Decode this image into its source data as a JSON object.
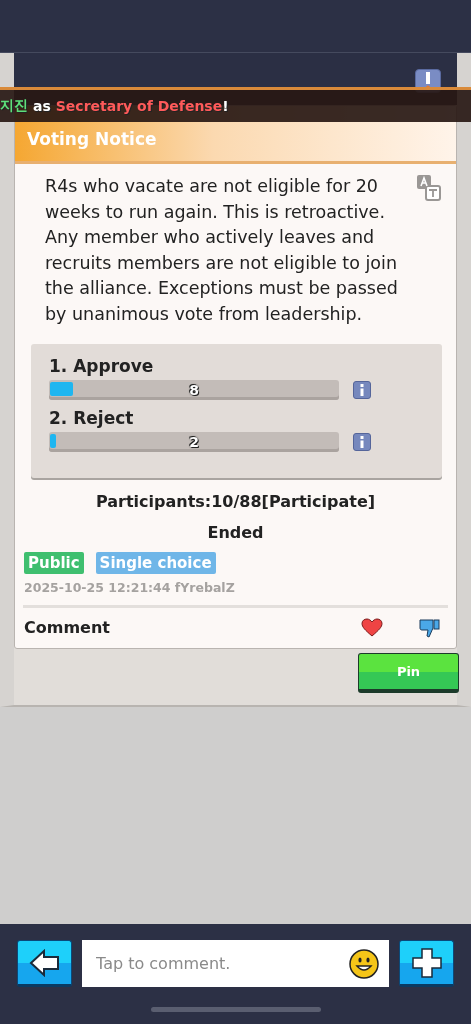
{
  "announcement": {
    "segments": [
      {
        "kind": "name",
        "text": "지진"
      },
      {
        "kind": "plain",
        "text": "as"
      },
      {
        "kind": "title",
        "text": "Secretary of Defense"
      },
      {
        "kind": "plain",
        "text": "!"
      }
    ]
  },
  "notice": {
    "title": "Voting Notice",
    "body": "R4s who vacate are not eligible for 20 weeks to run again. This is retroactive. Any member who actively leaves and recruits members are not eligible to join the alliance. Exceptions must be passed by unanimous vote from leadership.",
    "options": [
      {
        "label": "1. Approve",
        "count": "8",
        "level": 0.08
      },
      {
        "label": "2. Reject",
        "count": "2",
        "level": 0.02
      }
    ],
    "participants": "Participants:10/88[Participate]",
    "status": "Ended",
    "tags": [
      {
        "text": "Public",
        "color": "#3fbf6f"
      },
      {
        "text": "Single choice",
        "color": "#6fb6e8"
      }
    ],
    "meta": "2025-10-25 12:21:44 fYrebalZ",
    "comment_label": "Comment"
  },
  "pin_button": "Pin",
  "composer": {
    "placeholder": "Tap to comment."
  }
}
